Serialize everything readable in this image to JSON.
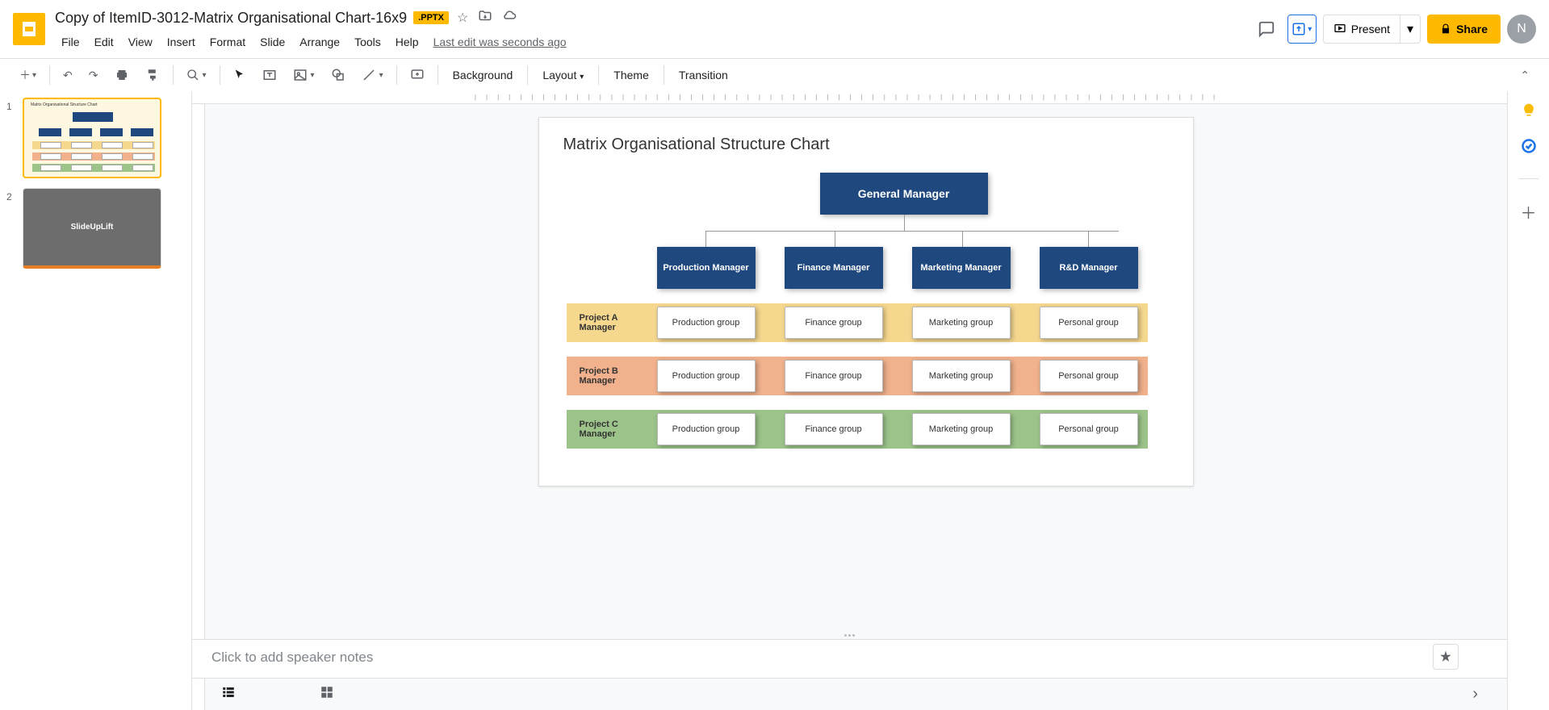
{
  "header": {
    "doc_title": "Copy of ItemID-3012-Matrix Organisational Chart-16x9",
    "badge": ".PPTX",
    "last_edit": "Last edit was seconds ago",
    "present": "Present",
    "share": "Share",
    "avatar_initial": "N"
  },
  "menu": {
    "file": "File",
    "edit": "Edit",
    "view": "View",
    "insert": "Insert",
    "format": "Format",
    "slide": "Slide",
    "arrange": "Arrange",
    "tools": "Tools",
    "help": "Help"
  },
  "toolbar": {
    "background": "Background",
    "layout": "Layout",
    "theme": "Theme",
    "transition": "Transition"
  },
  "thumbnails": {
    "n1": "1",
    "n2": "2",
    "t1_title": "Matrix Organisational Structure Chart",
    "t2_label": "SlideUpLift"
  },
  "slide": {
    "title": "Matrix Organisational Structure Chart",
    "gm": "General Manager",
    "managers": {
      "m0": "Production Manager",
      "m1": "Finance Manager",
      "m2": "Marketing Manager",
      "m3": "R&D Manager"
    },
    "projects": {
      "p0": "Project A Manager",
      "p1": "Project B Manager",
      "p2": "Project C Manager"
    },
    "groups": {
      "g0": "Production group",
      "g1": "Finance group",
      "g2": "Marketing group",
      "g3": "Personal group"
    }
  },
  "speaker": {
    "placeholder": "Click to add speaker notes"
  },
  "chart_data": {
    "type": "table",
    "title": "Matrix Organisational Structure Chart",
    "root": "General Manager",
    "columns": [
      "Production Manager",
      "Finance Manager",
      "Marketing Manager",
      "R&D Manager"
    ],
    "rows": [
      "Project A Manager",
      "Project B Manager",
      "Project C Manager"
    ],
    "cells": [
      [
        "Production group",
        "Finance group",
        "Marketing group",
        "Personal group"
      ],
      [
        "Production group",
        "Finance group",
        "Marketing group",
        "Personal group"
      ],
      [
        "Production group",
        "Finance group",
        "Marketing group",
        "Personal group"
      ]
    ]
  }
}
